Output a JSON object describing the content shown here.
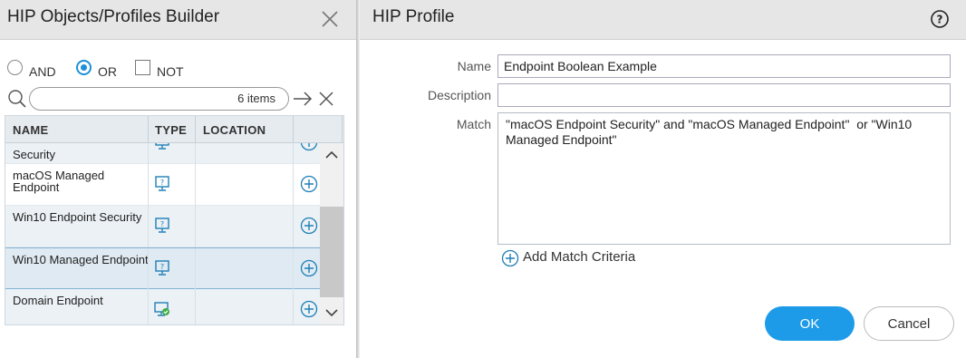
{
  "builder": {
    "title": "HIP Objects/Profiles Builder",
    "modes": [
      {
        "label": "AND",
        "selected": false
      },
      {
        "label": "OR",
        "selected": true
      },
      {
        "label": "NOT",
        "checked": false
      }
    ],
    "search": {
      "placeholder": "",
      "count_label": "6 items"
    },
    "table": {
      "columns": [
        "NAME",
        "TYPE",
        "LOCATION"
      ],
      "rows": [
        {
          "name": "Security",
          "type_icon": "hip-object-icon"
        },
        {
          "name": "macOS Managed Endpoint",
          "type_icon": "hip-object-icon"
        },
        {
          "name": "Win10 Endpoint Security",
          "type_icon": "hip-object-icon"
        },
        {
          "name": "Win10 Managed Endpoint",
          "type_icon": "hip-object-icon",
          "selected": true
        },
        {
          "name": "Domain Endpoint",
          "type_icon": "hip-profile-icon"
        }
      ]
    }
  },
  "profile": {
    "title": "HIP Profile",
    "name_label": "Name",
    "name_value": "Endpoint Boolean Example",
    "description_label": "Description",
    "description_value": "",
    "match_label": "Match",
    "match_value": "\"macOS Endpoint Security\" and \"macOS Managed Endpoint\"  or \"Win10 Managed Endpoint\"",
    "add_criteria_label": "Add Match Criteria",
    "ok_label": "OK",
    "cancel_label": "Cancel"
  },
  "colors": {
    "accent": "#1e9be8",
    "header_bg": "#e6e6e6",
    "selected_row": "#dfeaf2"
  }
}
